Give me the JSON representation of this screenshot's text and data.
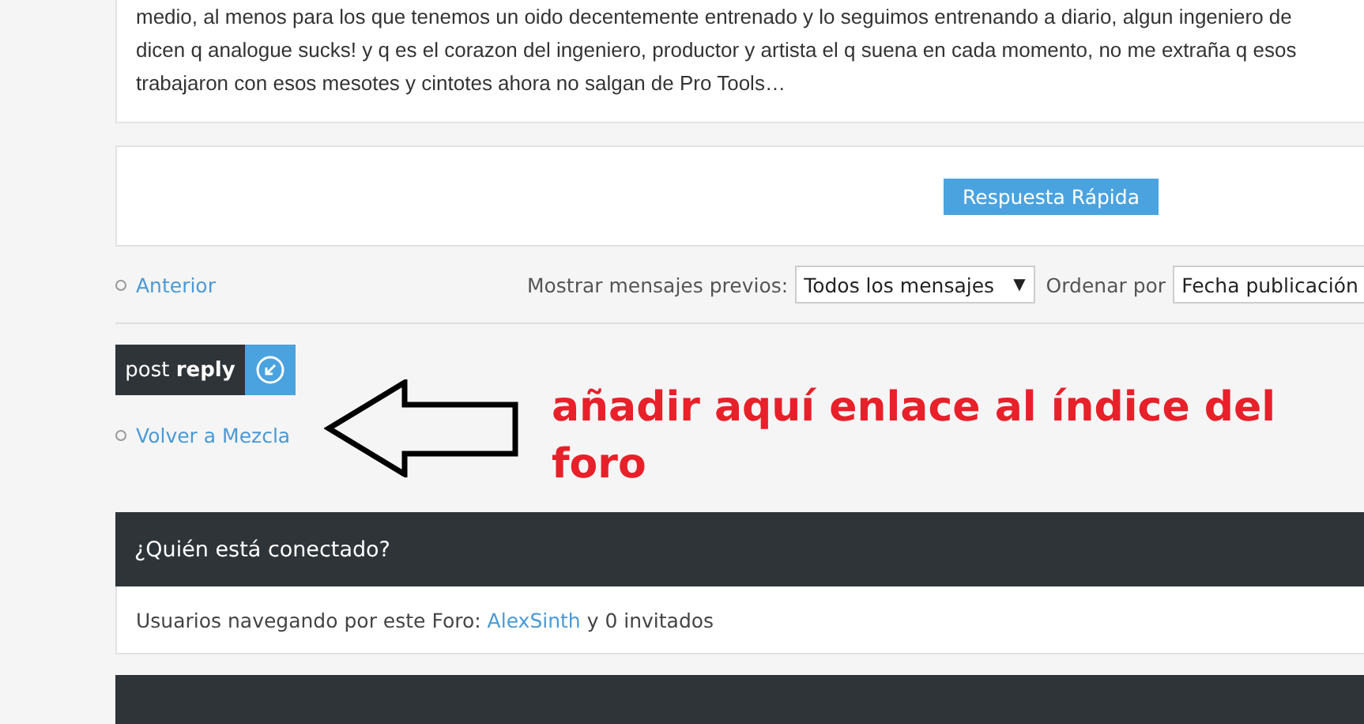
{
  "post": {
    "lines": [
      "medio, al menos para los que tenemos un oido decentemente entrenado y lo seguimos entrenando a diario, algun ingeniero de",
      "dicen q analogue sucks! y q es el corazon del ingeniero, productor y artista el q suena en cada momento, no me extraña q esos",
      "trabajaron con esos mesotes y cintotes ahora no salgan de Pro Tools…"
    ]
  },
  "quick_reply": {
    "button": "Respuesta Rápida"
  },
  "pagination": {
    "previous": "Anterior",
    "show_label": "Mostrar mensajes previos:",
    "show_value": "Todos los mensajes",
    "show_caret": "▼",
    "sort_label": "Ordenar por",
    "sort_value": "Fecha publicación"
  },
  "post_reply": {
    "label": "post **reply**"
  },
  "back_link": "Volver a Mezcla",
  "annotation": "añadir aquí enlace al índice del foro",
  "who_is_online": {
    "title": "¿Quién está conectado?",
    "prefix": "Usuarios navegando por este Foro: ",
    "user": "AlexSinth",
    "suffix": " y 0 invitados"
  }
}
